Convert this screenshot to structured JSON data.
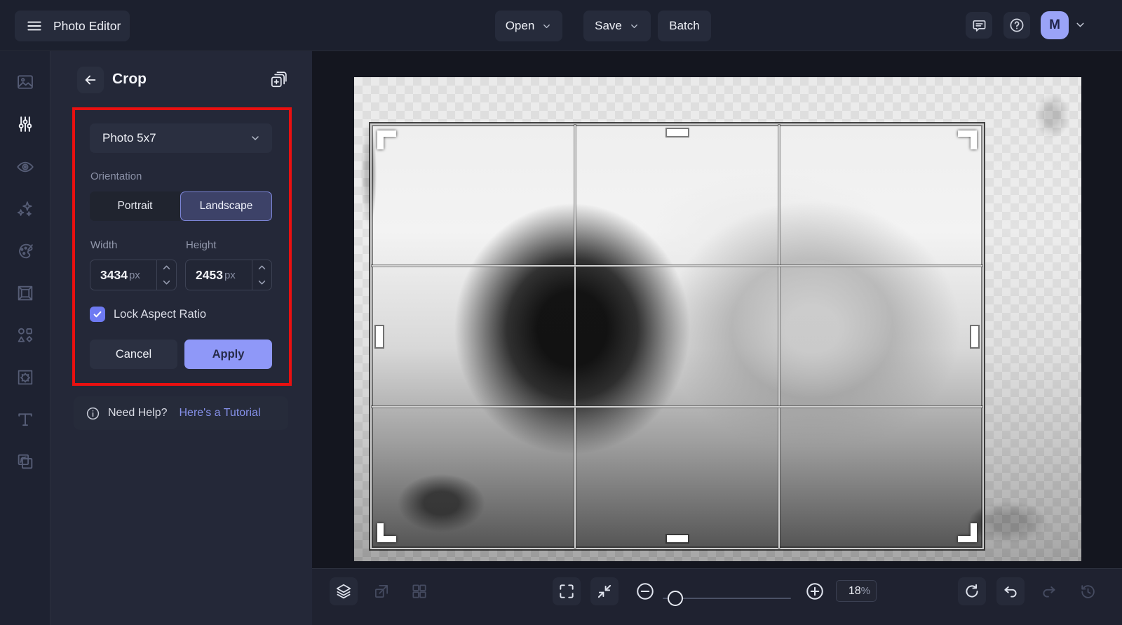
{
  "app": {
    "title": "Photo Editor"
  },
  "topbar": {
    "open": "Open",
    "save": "Save",
    "batch": "Batch",
    "avatar_initial": "M"
  },
  "sidebar": {
    "icons": [
      "image-manager-icon",
      "edit-sliders-icon",
      "touchup-eye-icon",
      "effects-sparkles-icon",
      "artsy-palette-icon",
      "frames-icon",
      "graphics-shapes-icon",
      "textures-pattern-icon",
      "text-tool-icon",
      "overlays-icon"
    ],
    "active": "edit-sliders-icon"
  },
  "crop_panel": {
    "title": "Crop",
    "preset": {
      "value": "Photo 5x7"
    },
    "orientation": {
      "label": "Orientation",
      "options": [
        "Portrait",
        "Landscape"
      ],
      "selected": "Landscape"
    },
    "width": {
      "label": "Width",
      "value": "3434",
      "unit": "px"
    },
    "height": {
      "label": "Height",
      "value": "2453",
      "unit": "px"
    },
    "lock_aspect": {
      "label": "Lock Aspect Ratio",
      "checked": true
    },
    "cancel": "Cancel",
    "apply": "Apply",
    "help": {
      "prefix": "Need Help?",
      "link": "Here's a Tutorial"
    }
  },
  "bottombar": {
    "zoom_value": "18",
    "zoom_unit": "%"
  },
  "colors": {
    "accent": "#8f98f8",
    "checkbox": "#6e7af2",
    "avatar": "#9aa3f7",
    "link": "#8590e8",
    "annotation_red": "#e81010",
    "topbar_bg": "#1c202e",
    "panel_bg": "#242838",
    "selected_toggle_bg": "#3d4268",
    "selected_toggle_border": "#7e87da"
  }
}
